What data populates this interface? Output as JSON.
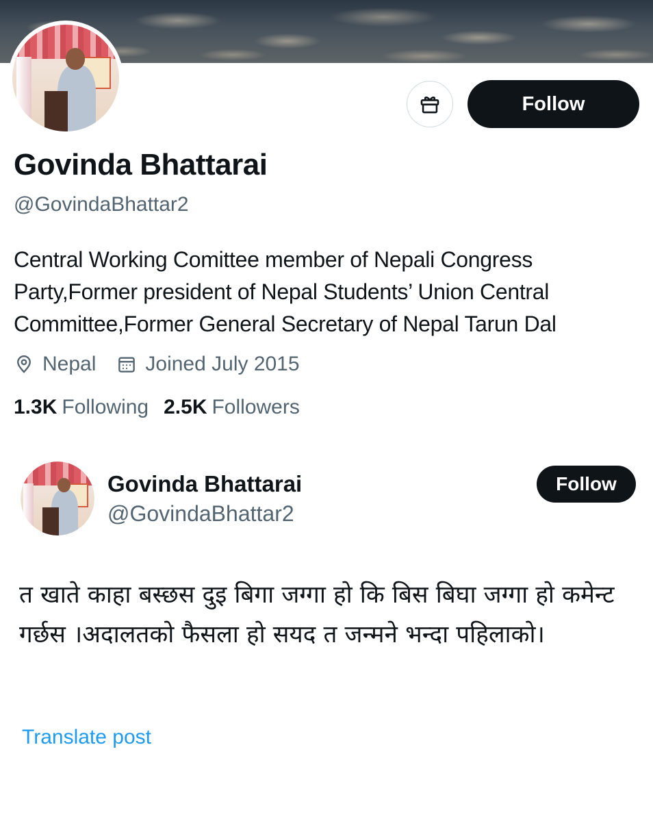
{
  "profile": {
    "name": "Govinda Bhattarai",
    "handle": "@GovindaBhattar2",
    "bio": "Central Working Comittee member of Nepali Congress Party,Former president of Nepal Students’ Union Central Committee,Former General Secretary of Nepal Tarun Dal",
    "location": "Nepal",
    "joined": "Joined July 2015",
    "following_count": "1.3K",
    "following_label": "Following",
    "followers_count": "2.5K",
    "followers_label": "Followers",
    "follow_label": "Follow",
    "gift_icon": "gift-icon"
  },
  "post": {
    "author_name": "Govinda Bhattarai",
    "author_handle": "@GovindaBhattar2",
    "follow_label": "Follow",
    "text": "त खाते काहा बस्छस दुइ बिगा जग्गा हो कि बिस बिघा जग्गा हो कमेन्ट गर्छस ।अदालतको फैसला हो सयद त जन्मने भन्दा पहिलाको।",
    "translate_label": "Translate post"
  },
  "colors": {
    "text_primary": "#0f1419",
    "text_secondary": "#536471",
    "link": "#1d9bf0",
    "button_dark": "#0f1419"
  }
}
